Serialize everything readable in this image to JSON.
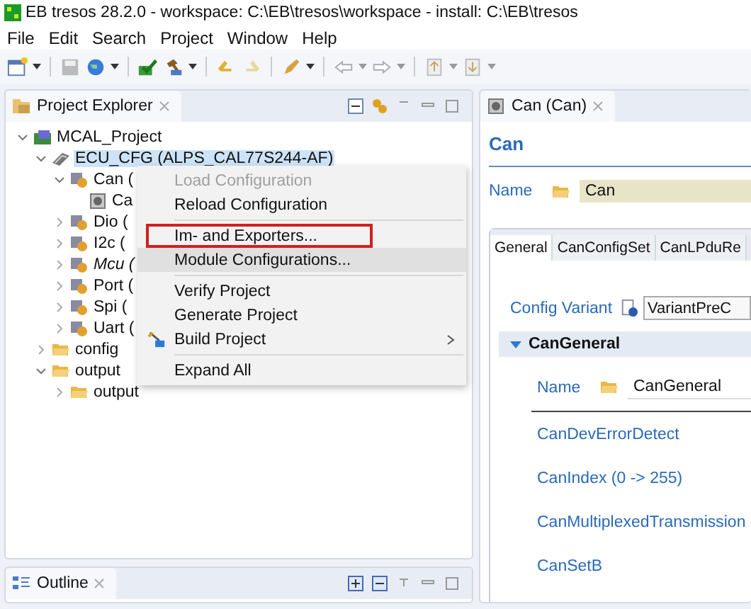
{
  "title_bar": {
    "title": "EB tresos 28.2.0 - workspace: C:\\EB\\tresos\\workspace - install: C:\\EB\\tresos"
  },
  "menu_bar": [
    {
      "label": "File"
    },
    {
      "label": "Edit"
    },
    {
      "label": "Search"
    },
    {
      "label": "Project"
    },
    {
      "label": "Window"
    },
    {
      "label": "Help"
    }
  ],
  "project_explorer": {
    "title": "Project Explorer",
    "tree": [
      {
        "label": "MCAL_Project",
        "kind": "project",
        "expanded": true,
        "italic": false,
        "children": [
          {
            "label": "ECU_CFG (ALPS_CAL77S244-AF)",
            "kind": "config",
            "expanded": true,
            "italic": false,
            "selected": true,
            "children": [
              {
                "label": "Can (",
                "kind": "module",
                "expanded": true,
                "italic": false,
                "selected": false,
                "children": [
                  {
                    "label": "Ca",
                    "kind": "file",
                    "italic": false,
                    "selected": false
                  }
                ]
              },
              {
                "label": "Dio (",
                "kind": "module",
                "expanded": false,
                "italic": false,
                "selected": false
              },
              {
                "label": "I2c (",
                "kind": "module",
                "expanded": false,
                "italic": false,
                "selected": false
              },
              {
                "label": "Mcu (",
                "kind": "module",
                "expanded": false,
                "italic": true,
                "selected": false
              },
              {
                "label": "Port (",
                "kind": "module",
                "expanded": false,
                "italic": false,
                "selected": false
              },
              {
                "label": "Spi (",
                "kind": "module",
                "expanded": false,
                "italic": false,
                "selected": false
              },
              {
                "label": "Uart (",
                "kind": "module",
                "expanded": false,
                "italic": false,
                "selected": false
              }
            ]
          },
          {
            "label": "config",
            "kind": "folder",
            "expanded": false,
            "italic": false,
            "selected": false
          },
          {
            "label": "output",
            "kind": "folder",
            "expanded": true,
            "italic": false,
            "selected": false,
            "children": [
              {
                "label": "output",
                "kind": "folder",
                "expanded": false,
                "italic": false,
                "selected": false
              }
            ]
          }
        ]
      }
    ]
  },
  "context_menu": [
    {
      "kind": "item",
      "label": "Load Configuration",
      "disabled": true,
      "hovered": false,
      "highlighted": false,
      "submenu": false
    },
    {
      "kind": "item",
      "label": "Reload Configuration",
      "disabled": false,
      "hovered": false,
      "highlighted": false,
      "submenu": false
    },
    {
      "kind": "separator"
    },
    {
      "kind": "item",
      "label": "Im- and Exporters...",
      "disabled": false,
      "hovered": false,
      "highlighted": true,
      "submenu": false
    },
    {
      "kind": "item",
      "label": "Module Configurations...",
      "disabled": false,
      "hovered": true,
      "highlighted": false,
      "submenu": false
    },
    {
      "kind": "separator"
    },
    {
      "kind": "item",
      "label": "Verify Project",
      "disabled": false,
      "hovered": false,
      "highlighted": false,
      "submenu": false
    },
    {
      "kind": "item",
      "label": "Generate Project",
      "disabled": false,
      "hovered": false,
      "highlighted": false,
      "submenu": false
    },
    {
      "kind": "item",
      "label": "Build Project",
      "disabled": false,
      "hovered": false,
      "highlighted": false,
      "submenu": true,
      "icon": true
    },
    {
      "kind": "separator"
    },
    {
      "kind": "item",
      "label": "Expand All",
      "disabled": false,
      "hovered": false,
      "highlighted": false,
      "submenu": false
    }
  ],
  "outline": {
    "title": "Outline"
  },
  "editor": {
    "tab": "Can (Can)",
    "heading": "Can",
    "name_label": "Name",
    "name_value": "Can",
    "tabs": [
      {
        "label": "General",
        "selected": true
      },
      {
        "label": "CanConfigSet",
        "selected": false
      },
      {
        "label": "CanLPduRe",
        "selected": false
      }
    ],
    "config_variant_label": "Config Variant",
    "config_variant_value": "VariantPreC",
    "section": {
      "title": "CanGeneral",
      "expanded": true,
      "name_label": "Name",
      "name_value": "CanGeneral",
      "params": [
        "CanDevErrorDetect",
        "CanIndex (0 -> 255)",
        "CanMultiplexedTransmission",
        "CanSetB"
      ]
    }
  }
}
